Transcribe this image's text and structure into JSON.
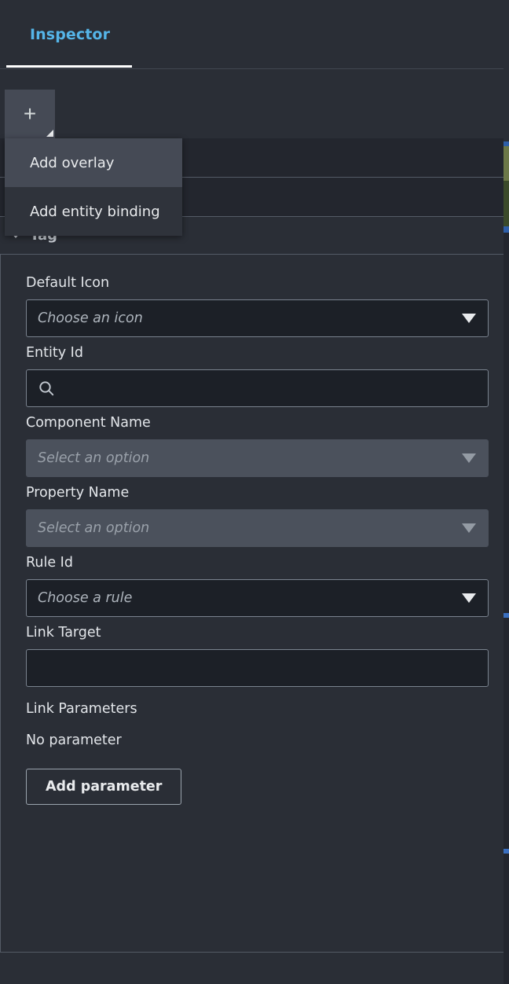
{
  "panel": {
    "tabs": [
      {
        "label": "Inspector",
        "active": true
      }
    ],
    "toolbar": {
      "add_button_glyph": "+",
      "add_button_name": "add-button"
    },
    "menu": {
      "items": [
        {
          "label": "Add overlay",
          "highlighted": true
        },
        {
          "label": "Add entity binding",
          "highlighted": false
        }
      ]
    },
    "section": {
      "title": "Tag",
      "expanded": true
    },
    "fields": [
      {
        "label": "Default Icon",
        "type": "select",
        "placeholder": "Choose an icon",
        "value": "",
        "disabled": false,
        "name": "default-icon-select"
      },
      {
        "label": "Entity Id",
        "type": "search",
        "placeholder": "",
        "value": "",
        "disabled": false,
        "name": "entity-id-input"
      },
      {
        "label": "Component Name",
        "type": "select",
        "placeholder": "Select an option",
        "value": "",
        "disabled": true,
        "name": "component-name-select"
      },
      {
        "label": "Property Name",
        "type": "select",
        "placeholder": "Select an option",
        "value": "",
        "disabled": true,
        "name": "property-name-select"
      },
      {
        "label": "Rule Id",
        "type": "select",
        "placeholder": "Choose a rule",
        "value": "",
        "disabled": false,
        "name": "rule-id-select"
      },
      {
        "label": "Link Target",
        "type": "text",
        "placeholder": "",
        "value": "",
        "disabled": false,
        "name": "link-target-input"
      }
    ],
    "link_parameters": {
      "label": "Link Parameters",
      "empty_text": "No parameter",
      "add_button_label": "Add parameter"
    }
  },
  "colors": {
    "panel_bg": "#2a2e36",
    "row_bg": "#23262e",
    "input_bg": "#1c2027",
    "disabled_bg": "#4b515c",
    "accent_tab": "#55b5e8",
    "border": "#545b66",
    "text": "#e3e6ea",
    "menu_bg": "#2f333b",
    "menu_highlight": "#454a55"
  }
}
